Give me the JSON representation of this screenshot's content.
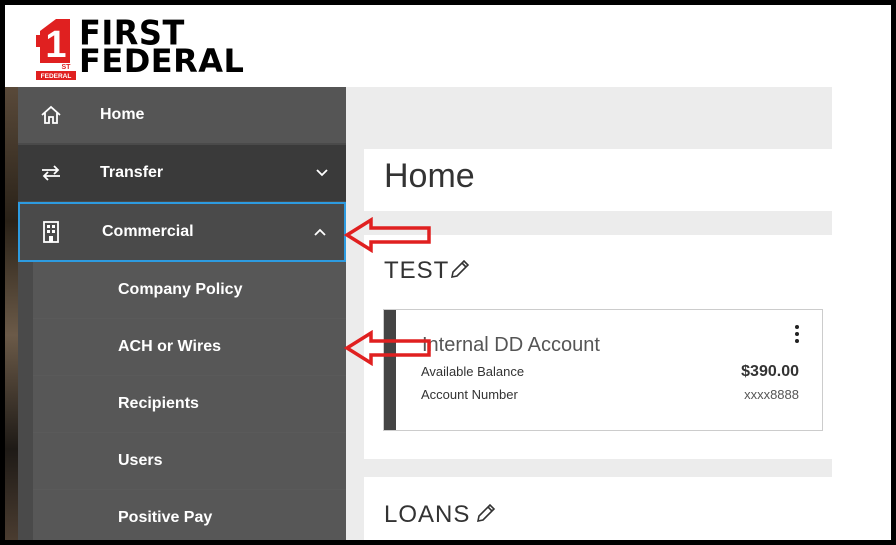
{
  "brand": {
    "line1": "FIRST",
    "line2": "FEDERAL",
    "badge": "1",
    "badge_sub": "ST",
    "badge_bottom": "FEDERAL"
  },
  "sidebar": {
    "items": [
      {
        "label": "Home",
        "icon": "home-icon"
      },
      {
        "label": "Transfer",
        "icon": "transfer-icon",
        "chevron": "chevron-down-icon"
      },
      {
        "label": "Commercial",
        "icon": "building-icon",
        "chevron": "chevron-up-icon"
      }
    ],
    "subitems": [
      "Company Policy",
      "ACH or Wires",
      "Recipients",
      "Users",
      "Positive Pay"
    ]
  },
  "main": {
    "title": "Home",
    "groups": [
      {
        "name": "TEST",
        "account": {
          "name": "Internal DD Account",
          "balance_label": "Available Balance",
          "balance": "$390.00",
          "number_label": "Account Number",
          "number": "xxxx8888"
        }
      },
      {
        "name": "LOANS"
      }
    ]
  },
  "annotations": {
    "arrow_color": "#e02020"
  },
  "colors": {
    "sidebar": "#4a4a4a",
    "active_border": "#2d9be0",
    "logo_red": "#e02020"
  }
}
